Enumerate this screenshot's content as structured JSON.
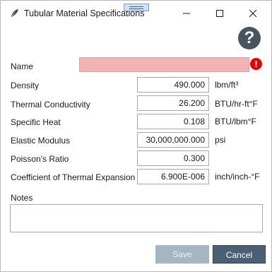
{
  "window": {
    "title": "Tubular Material Specifications",
    "app_icon": "feather-icon",
    "controls": [
      "minimize-icon",
      "maximize-icon",
      "close-icon"
    ]
  },
  "help": {
    "icon": "question-icon",
    "glyph": "?"
  },
  "name": {
    "label": "Name",
    "value": "",
    "error_icon": "exclamation-icon",
    "error_glyph": "!"
  },
  "properties": [
    {
      "label": "Density",
      "value": "490.000",
      "unit": "lbm/ft³"
    },
    {
      "label": "Thermal Conductivity",
      "value": "26.200",
      "unit": "BTU/hr-ft°F"
    },
    {
      "label": "Specific Heat",
      "value": "0.108",
      "unit": "BTU/lbm°F"
    },
    {
      "label": "Elastic Modulus",
      "value": "30,000,000.000",
      "unit": "psi"
    },
    {
      "label": "Poisson's Ratio",
      "value": "0.300",
      "unit": ""
    },
    {
      "label": "Coefficient of Thermal Expansion",
      "value": "6.900E-006",
      "unit": "inch/inch-°F"
    }
  ],
  "notes": {
    "label": "Notes",
    "value": ""
  },
  "buttons": {
    "save": "Save",
    "cancel": "Cancel"
  },
  "colors": {
    "error_fill": "#f4b3b3",
    "error_icon": "#e60000",
    "save_disabled": "#a6b5c2",
    "cancel": "#4b5f75"
  }
}
